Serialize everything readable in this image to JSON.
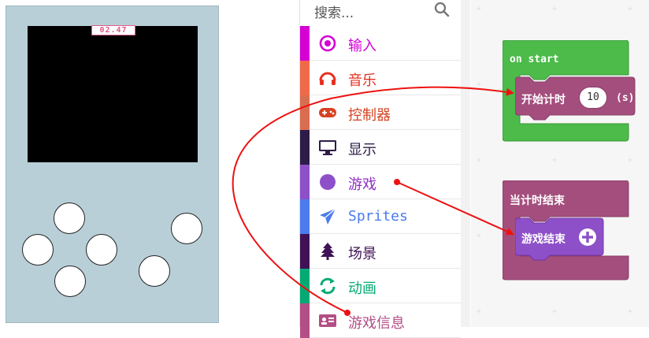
{
  "simulator": {
    "timer_display": "02.47"
  },
  "toolbox": {
    "search_placeholder": "搜索...",
    "categories": [
      {
        "label": "输入",
        "color": "#d400d4",
        "icon": "circle-dot-icon"
      },
      {
        "label": "音乐",
        "color": "#e63022",
        "icon": "headphones-icon"
      },
      {
        "label": "控制器",
        "color": "#d54322",
        "icon": "gamepad-icon"
      },
      {
        "label": "显示",
        "color": "#2d1c47",
        "icon": "monitor-icon"
      },
      {
        "label": "游戏",
        "color": "#8e2ec4",
        "icon": "circle-icon"
      },
      {
        "label": "Sprites",
        "color": "#4b7bec",
        "icon": "paper-plane-icon"
      },
      {
        "label": "场景",
        "color": "#401255",
        "icon": "tree-icon"
      },
      {
        "label": "动画",
        "color": "#03aa74",
        "icon": "refresh-icon"
      },
      {
        "label": "游戏信息",
        "color": "#b34e86",
        "icon": "id-card-icon"
      }
    ]
  },
  "workspace": {
    "on_start_block": {
      "label": "on start",
      "color": "#4cbb4a"
    },
    "start_timer_block": {
      "label": "开始计时",
      "value": "10",
      "unit": "(s)",
      "color": "#a44e7d"
    },
    "timer_end_block": {
      "label": "当计时结束",
      "color": "#a44e7d"
    },
    "game_over_block": {
      "label": "游戏结束",
      "color": "#8e2ec4"
    }
  }
}
